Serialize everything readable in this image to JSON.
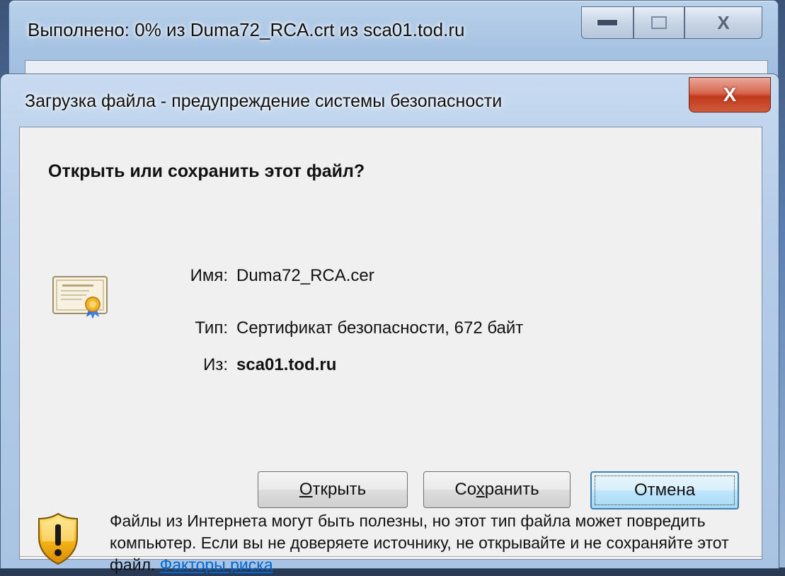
{
  "back_window": {
    "title": "Выполнено: 0% из Duma72_RCA.crt из sca01.tod.ru",
    "close_glyph": "X"
  },
  "dialog": {
    "title": "Загрузка файла - предупреждение системы безопасности",
    "close_glyph": "X",
    "question": "Открыть или сохранить этот файл?",
    "fields": {
      "name_label": "Имя:",
      "name_value": "Duma72_RCA.cer",
      "type_label": "Тип:",
      "type_value": "Сертификат безопасности, 672 байт",
      "from_label": "Из:",
      "from_value": "sca01.tod.ru"
    },
    "buttons": {
      "open": {
        "prefix": "",
        "mnemonic": "О",
        "rest": "ткрыть"
      },
      "save": {
        "prefix": "Со",
        "mnemonic": "х",
        "rest": "ранить"
      },
      "cancel": "Отмена"
    },
    "warning_text": "Файлы из Интернета могут быть полезны, но этот тип файла может повредить компьютер. Если вы не доверяете источнику, не открывайте и не сохраняйте этот файл.",
    "risk_link": "Факторы риска",
    "icons": {
      "file": "certificate-icon",
      "warning": "shield-warning-icon"
    }
  }
}
